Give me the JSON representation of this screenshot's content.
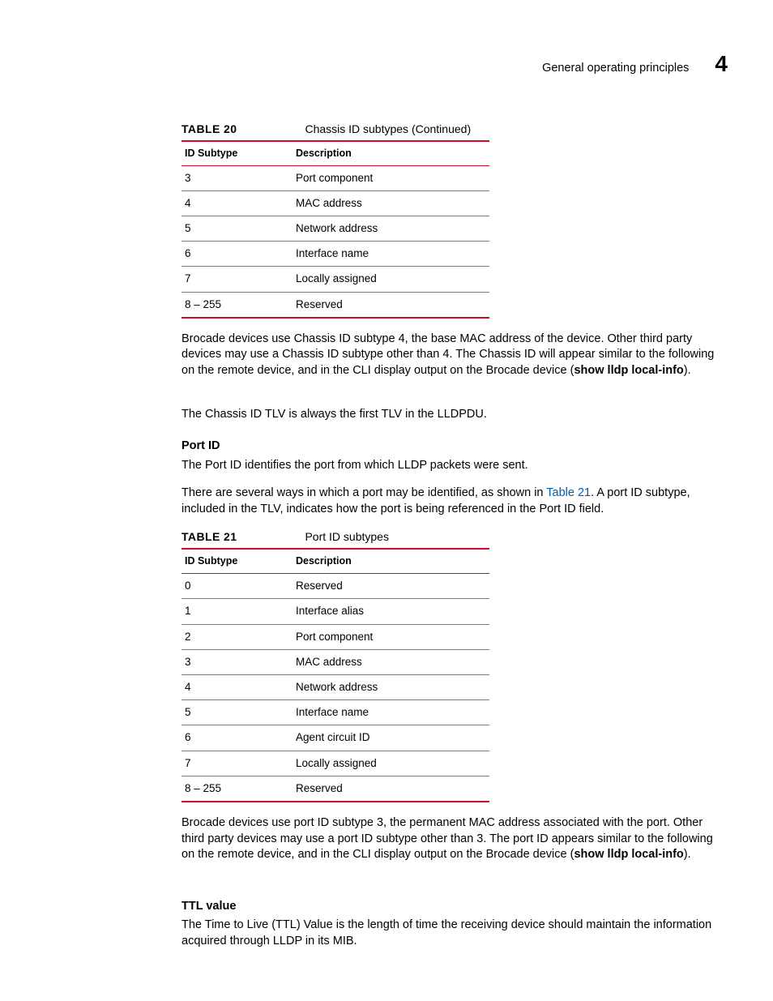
{
  "header": {
    "title": "General operating principles",
    "chapter": "4"
  },
  "table20": {
    "label": "TABLE 20",
    "caption": "Chassis ID subtypes (Continued)",
    "head": {
      "c1": "ID Subtype",
      "c2": "Description"
    },
    "rows": [
      {
        "c1": "3",
        "c2": "Port component"
      },
      {
        "c1": "4",
        "c2": "MAC address"
      },
      {
        "c1": "5",
        "c2": "Network address"
      },
      {
        "c1": "6",
        "c2": "Interface name"
      },
      {
        "c1": "7",
        "c2": "Locally assigned"
      },
      {
        "c1": "8 – 255",
        "c2": "Reserved"
      }
    ]
  },
  "para1a": "Brocade devices use Chassis ID subtype 4, the base MAC address of the device. Other third party devices may use a Chassis ID subtype other than 4. The Chassis ID will appear similar to the following on the remote device, and in the CLI display output on the Brocade device (",
  "para1b": "show lldp local-info",
  "para1c": ").",
  "para2": "The Chassis ID TLV is always the first TLV in the LLDPDU.",
  "portid_head": "Port ID",
  "para3": "The Port ID identifies the port from which LLDP packets were sent.",
  "para4a": "There are several ways in which a port may be identified, as shown in ",
  "para4link": "Table 21",
  "para4b": ". A port ID subtype, included in the TLV, indicates how the port is being referenced in the Port ID field.",
  "table21": {
    "label": "TABLE 21",
    "caption": "Port ID subtypes",
    "head": {
      "c1": "ID Subtype",
      "c2": "Description"
    },
    "rows": [
      {
        "c1": "0",
        "c2": "Reserved"
      },
      {
        "c1": "1",
        "c2": "Interface alias"
      },
      {
        "c1": "2",
        "c2": "Port component"
      },
      {
        "c1": "3",
        "c2": "MAC address"
      },
      {
        "c1": "4",
        "c2": "Network address"
      },
      {
        "c1": "5",
        "c2": "Interface name"
      },
      {
        "c1": "6",
        "c2": "Agent circuit ID"
      },
      {
        "c1": "7",
        "c2": "Locally assigned"
      },
      {
        "c1": "8 – 255",
        "c2": "Reserved"
      }
    ]
  },
  "para5a": "Brocade devices use port ID subtype 3, the permanent MAC address associated with the port. Other third party devices may use a port ID subtype other than 3. The port ID appears similar to the following on the remote device, and in the CLI display output on the Brocade device (",
  "para5b": "show lldp local-info",
  "para5c": ").",
  "ttl_head": "TTL value",
  "para6": "The Time to Live (TTL) Value is the length of time the receiving device should maintain the information acquired through LLDP in its MIB."
}
